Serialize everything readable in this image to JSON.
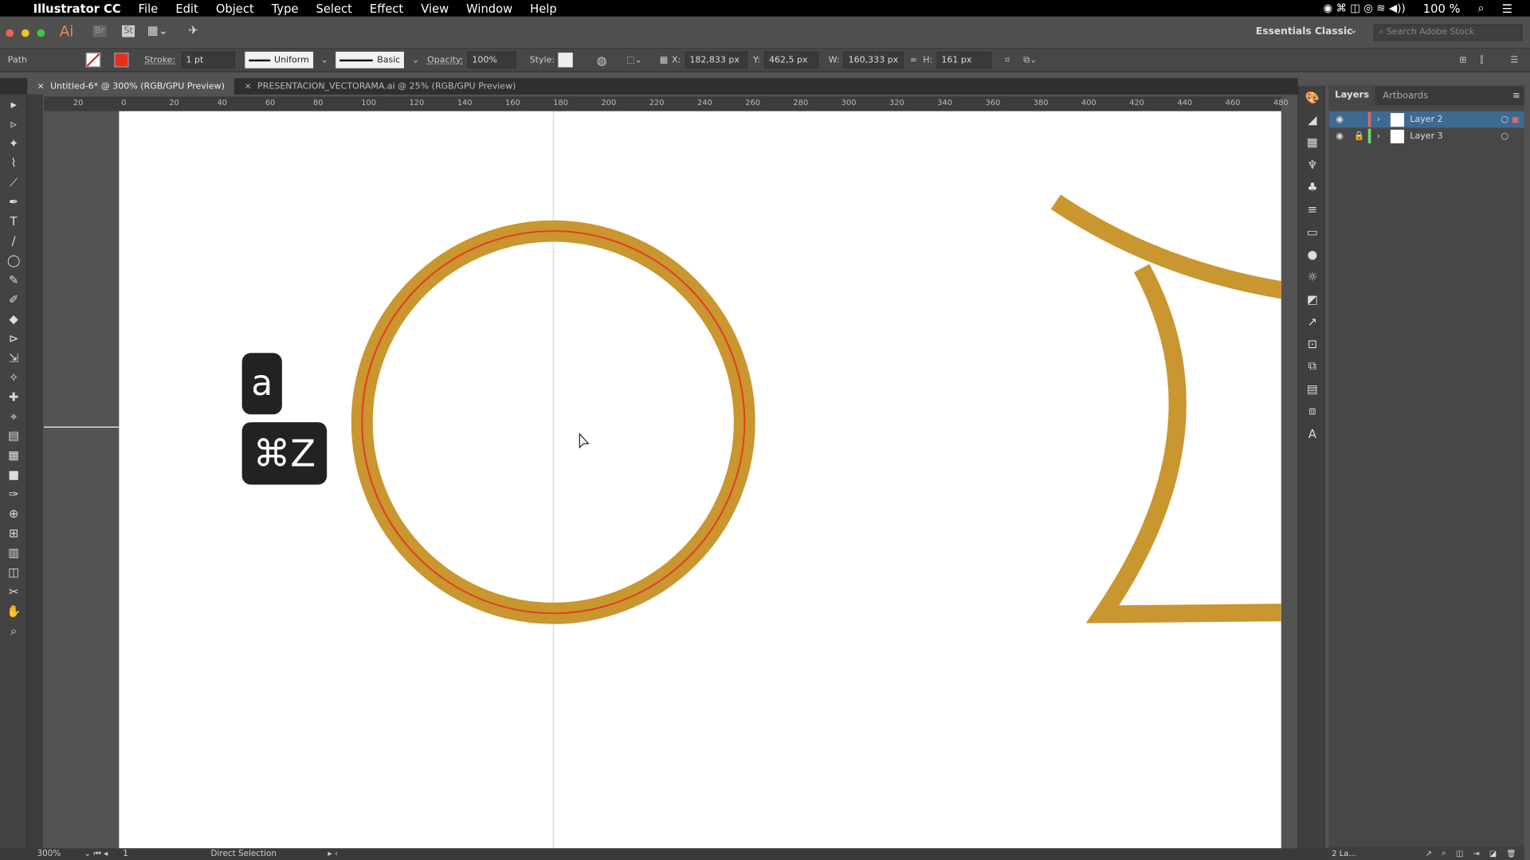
{
  "menubar": {
    "app": "Illustrator CC",
    "items": [
      "File",
      "Edit",
      "Object",
      "Type",
      "Select",
      "Effect",
      "View",
      "Window",
      "Help"
    ],
    "battery": "100 %"
  },
  "appbar": {
    "logo": "Ai",
    "bridge": "Br",
    "stock": "St",
    "workspace": "Essentials Classic",
    "search_placeholder": "Search Adobe Stock"
  },
  "control": {
    "selection": "Path",
    "stroke_label": "Stroke:",
    "stroke_value": "1 pt",
    "profile": "Uniform",
    "brush": "Basic",
    "opacity_label": "Opacity:",
    "opacity": "100%",
    "style_label": "Style:",
    "x_label": "X:",
    "x": "182,833 px",
    "y_label": "Y:",
    "y": "462,5 px",
    "w_label": "W:",
    "w": "160,333 px",
    "h_label": "H:",
    "h": "161 px"
  },
  "tabs": [
    {
      "label": "Untitled-6* @ 300% (RGB/GPU Preview)",
      "active": true
    },
    {
      "label": "PRESENTACION_VECTORAMA.ai @ 25% (RGB/GPU Preview)",
      "active": false
    }
  ],
  "ruler": [
    "20",
    "0",
    "20",
    "40",
    "60",
    "80",
    "100",
    "120",
    "140",
    "160",
    "180",
    "200",
    "220",
    "240",
    "260",
    "280",
    "300",
    "320",
    "340",
    "360",
    "380",
    "400",
    "420",
    "440",
    "460",
    "480"
  ],
  "tools": [
    "▸",
    "▹",
    "✦",
    "⌇",
    "⟋",
    "✒",
    "T",
    "/",
    "◯",
    "✎",
    "✐",
    "◆",
    "⊳",
    "⇲",
    "✧",
    "✚",
    "⌖",
    "▤",
    "▦",
    "■",
    "✑",
    "⊕",
    "⊞",
    "▥",
    "◫",
    "✂",
    "✋",
    "⌕"
  ],
  "panel_icons": [
    "🎨",
    "◢",
    "▦",
    "♆",
    "♣",
    "≡",
    "▭",
    "●",
    "☼",
    "◩",
    "↗",
    "⊡",
    "⧉",
    "▤",
    "⧈",
    "A"
  ],
  "layers": {
    "tabs": [
      "Layers",
      "Artboards"
    ],
    "items": [
      {
        "name": "Layer 2",
        "color": "#e06666",
        "selected": true
      },
      {
        "name": "Layer 3",
        "color": "#66dd66",
        "selected": false
      }
    ],
    "count": "2 La..."
  },
  "keys": {
    "key1": "a",
    "key2": "⌘Z"
  },
  "status": {
    "zoom": "300%",
    "artboard": "1",
    "tool": "Direct Selection"
  },
  "colors": {
    "stroke_gold": "#c9962f",
    "path_red": "#e83a1c",
    "selection": "#3d6a90"
  }
}
